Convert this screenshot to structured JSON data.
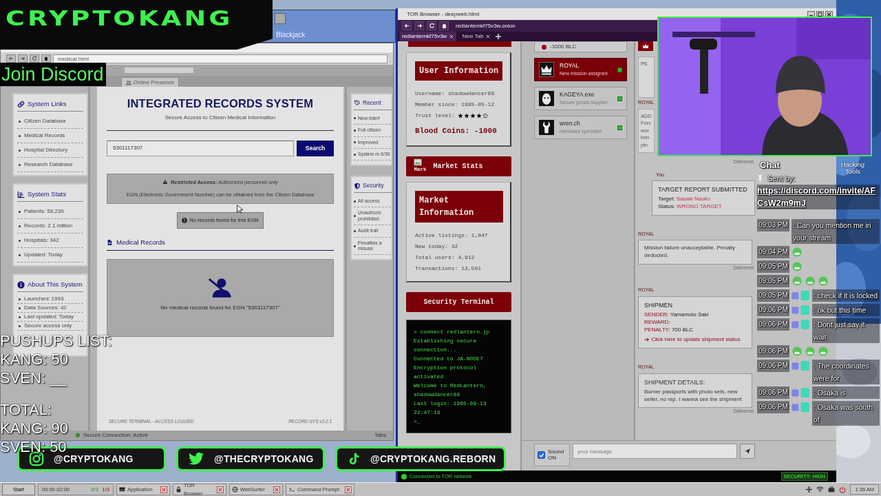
{
  "background_window": {
    "title": "Blackjack"
  },
  "medical_window": {
    "address": "medical.html",
    "tab": "Online Presence",
    "sidebar": [
      {
        "kind": "links",
        "title": "System Links",
        "items": [
          "Citizen Database",
          "Medical Records",
          "Hospital Directory",
          "Research Database"
        ]
      },
      {
        "kind": "stats",
        "title": "System Stats",
        "items": [
          "Patients: 58,239",
          "Records: 2.1 million",
          "Hospitals: 342",
          "Updated: Today"
        ]
      },
      {
        "kind": "about",
        "title": "About This System",
        "items": [
          "Launched: 1993",
          "Data Sources: 42",
          "Last updated: Today",
          "Secure access only"
        ]
      }
    ],
    "title": "INTEGRATED RECORDS SYSTEM",
    "subtitle": "Secure Access to Citizen Medical Information",
    "search": {
      "value": "5301117307",
      "button": "Search"
    },
    "alert": {
      "headline": "**Restricted Access:** Authorized personnel only",
      "detail": "EGN (Electronic Government Number) can be obtained from the Citizen Database"
    },
    "notice": "No records found for this EGN",
    "section_title": "Medical Records",
    "empty_message": "No medical records found for EGN \"5301117307\"",
    "footer": {
      "left": "SECURE TERMINAL - ACCESS LOGGED",
      "right": "RECORD-SYS v3.2.1"
    },
    "side_panels": [
      {
        "kind": "recent",
        "title": "Recent",
        "items": [
          "New interf",
          "Full citizen",
          "Improved",
          "System m 6/30"
        ]
      },
      {
        "kind": "security",
        "title": "Security",
        "items": [
          "All access",
          "Unauthoriz prohibited",
          "Audit trail",
          "Penalties a misuse"
        ]
      }
    ],
    "status": "Secure Connection: Active",
    "tabs_label": "Tabs:"
  },
  "tor_window": {
    "title": "TOR Browser - deepweb.html",
    "url": "redlanternkf75v3w.onion",
    "tabs": [
      {
        "label": "redlanternkf75v3w",
        "selected": true
      },
      {
        "label": "New Tab",
        "selected": false
      }
    ],
    "user_info": {
      "title": "User Information",
      "username": "Username: shadowdancer89",
      "member_since": "Member since: 1995-05-12",
      "trust_label": "Trust level:",
      "stars": 4,
      "coins": "Blood Coins: -1000"
    },
    "market_stats": {
      "title": "Market Stats",
      "image_alt": "Mark"
    },
    "market_info": {
      "title": "Market Information",
      "lines": [
        "Active listings: 1,047",
        "New today: 32",
        "Total users: 4,912",
        "Transactions: 12,501"
      ]
    },
    "terminal": {
      "title": "Security Terminal",
      "lines": [
        "> connect redlantern.jp",
        "Establishing secure connection...",
        "Connected to JA-NODE7",
        "Encryption protocol activated",
        "Welcome to RedLantern, shadowdancer89",
        "Last login: 1995-09-13 22:47:13",
        ">_"
      ]
    },
    "balance": "-1000 BLC",
    "contacts": [
      {
        "kind": "crown",
        "name": "ROYAL",
        "note": "New mission assigned",
        "selected": true,
        "online": true
      },
      {
        "kind": "mask",
        "name": "KAGEYA.exe",
        "note": "Secure goods supplier",
        "selected": false,
        "online": true
      },
      {
        "kind": "wrench",
        "name": "wren.ch",
        "note": "Hardware specialist",
        "selected": false,
        "online": true
      }
    ],
    "chat": {
      "partial": {
        "label": "PE",
        "sender": "ROYAL",
        "lines": [
          "ADD",
          "Forc",
          "wor",
          "brin",
          "pin."
        ],
        "status": "Delivered"
      },
      "messages": [
        {
          "kind": "report",
          "outgoing": true,
          "sender": "You",
          "title": "TARGET REPORT SUBMITTED",
          "fields": [
            {
              "label": "Target:",
              "value": "Sasaki Naoko"
            },
            {
              "label": "Status:",
              "value": "WRONG TARGET"
            }
          ]
        },
        {
          "kind": "note",
          "outgoing": false,
          "sender": "ROYAL",
          "text": "Mission failure unacceptable. Penalty deducted.",
          "status": "Delivered"
        },
        {
          "kind": "shipment",
          "outgoing": false,
          "sender": "ROYAL",
          "title": "SHIPMEN",
          "fields": [
            {
              "label": "SENDER:",
              "value": "Yamamoto Saki"
            },
            {
              "label": "REWARD:"
            },
            {
              "label": "PENALTY:",
              "value": "700 BLC"
            }
          ],
          "action": "Click here to update shipment status"
        },
        {
          "kind": "note",
          "outgoing": false,
          "sender": "ROYAL",
          "title": "SHIPMENT DETAILS:",
          "text": "Burner passports with photo sets, new seller, no rep. I wanna see the shipment",
          "status": "Delivered"
        }
      ],
      "placeholder": "your message",
      "sound": {
        "label": "Sound ON",
        "checked": true
      }
    },
    "status": "Connected to TOR network",
    "security": "SECURITY: HIGH"
  },
  "desktop": {
    "icon_label": "Hacking Tools"
  },
  "taskbar": {
    "start": "Start",
    "schedule": "00:00-02:00",
    "progress": [
      "0/3",
      "1/3"
    ],
    "tasks": [
      {
        "kind": "app",
        "label": "Application"
      },
      {
        "kind": "tor",
        "label": "TOR Browser"
      },
      {
        "kind": "web",
        "label": "WebSurfer"
      },
      {
        "kind": "prompt",
        "label": "Command Prompt"
      }
    ],
    "clock": "1:36 AM"
  },
  "overlay": {
    "logo": "CRYPTOKANG",
    "discord_banner": "Join Discord",
    "pushups": {
      "title": "PUSHUPS LIST:",
      "lines": [
        "KANG: 50",
        "SVEN: __"
      ]
    },
    "total": {
      "title": "TOTAL:",
      "lines": [
        "KANG: 90",
        "SVEN: 50"
      ]
    },
    "socials": [
      {
        "kind": "instagram",
        "handle": "@CRYPTOKANG"
      },
      {
        "kind": "twitter",
        "handle": "@THECRYPTOKANG"
      },
      {
        "kind": "tiktok",
        "handle": "@CRYPTOKANG.REBORN"
      }
    ],
    "chat": {
      "title": "Chat",
      "pinned": {
        "label": "Sent by:",
        "link": "https://discord.com/invite/AFCsW2m9mJ"
      },
      "messages": [
        {
          "kind": "text",
          "time": "09:03 PM",
          "badges": false,
          "text": ": Can you mention me in your stream"
        },
        {
          "kind": "emote",
          "time": "09:04 PM",
          "badges": false
        },
        {
          "kind": "emote",
          "time": "09:05 PM",
          "badges": false
        },
        {
          "kind": "emotes",
          "time": "09:05 PM",
          "badges": false
        },
        {
          "kind": "text",
          "time": "09:05 PM",
          "badges": true,
          "text": ": check if it is locked"
        },
        {
          "kind": "text",
          "time": "09:06 PM",
          "badges": true,
          "text": ": ok but this time"
        },
        {
          "kind": "text",
          "time": "09:06 PM",
          "badges": true,
          "text": ": Dont just say it wait"
        },
        {
          "kind": "emotes",
          "time": "09:06 PM",
          "badges": false
        },
        {
          "kind": "text",
          "time": "09:06 PM",
          "badges": true,
          "text": ": The coordinates were for"
        },
        {
          "kind": "text",
          "time": "09:06 PM",
          "badges": true,
          "text": ": Osaka is"
        },
        {
          "kind": "text",
          "time": "09:06 PM",
          "badges": true,
          "text": ": Osaka was south of"
        }
      ]
    }
  }
}
